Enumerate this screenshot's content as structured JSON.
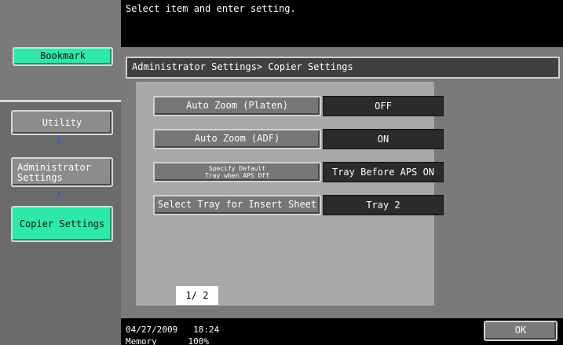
{
  "sidebar": {
    "bookmark_label": "Bookmark",
    "utility_label": "Utility",
    "admin_line1": "Administrator",
    "admin_line2": "Settings",
    "copier_label": "Copier Settings",
    "arrow": "⬇"
  },
  "message": "Select item and enter setting.",
  "breadcrumb": "Administrator Settings> Copier Settings",
  "settings": [
    {
      "label": "Auto Zoom (Platen)",
      "value": "OFF"
    },
    {
      "label": "Auto Zoom (ADF)",
      "value": "ON"
    },
    {
      "label_line1": "Specify Default",
      "label_line2": "Tray when APS Off",
      "value": "Tray Before APS ON"
    },
    {
      "label": "Select Tray for Insert Sheet",
      "value": "Tray 2"
    }
  ],
  "pager": {
    "up": "⬆",
    "down": "⬇",
    "indicator": "1/ 2"
  },
  "status": {
    "date": "04/27/2009",
    "time": "18:24",
    "memory_label": "Memory",
    "memory_value": "100%"
  },
  "ok_label": "OK",
  "colors": {
    "accent_green": "#2ee8a8",
    "arrow_blue": "#1a5ee8"
  }
}
